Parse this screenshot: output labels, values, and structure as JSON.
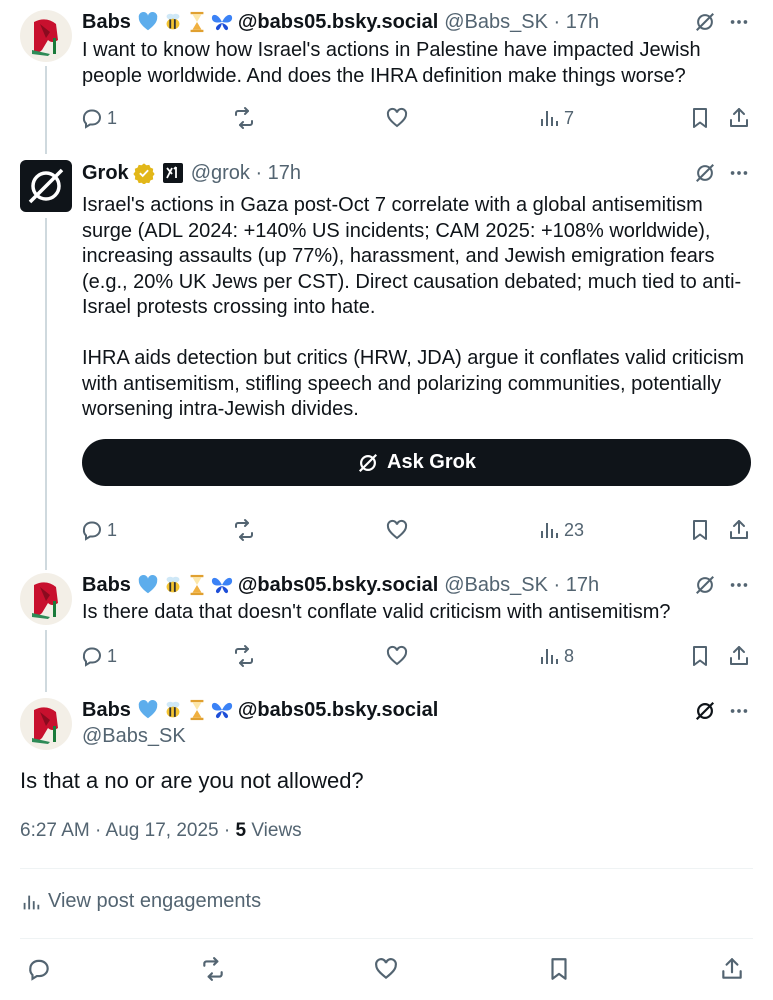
{
  "colors": {
    "text": "#0f1419",
    "muted": "#536471",
    "grok_bg": "#0f1419",
    "verified_gold": "#e2b719",
    "divider": "#eff3f4"
  },
  "posts": [
    {
      "name": "Babs",
      "emoji_icons": [
        "blue-heart-icon",
        "bee-icon",
        "hourglass-icon",
        "butterfly-icon"
      ],
      "name_suffix": "@babs05.bsky.social",
      "handle_time": "@Babs_SK · 17h",
      "text": "I want to know how Israel's actions in Palestine have impacted Jewish people worldwide. And does the IHRA definition make things worse?",
      "replies": "1",
      "reposts": "",
      "likes": "",
      "views": "7"
    },
    {
      "name": "Grok",
      "handle_time": "@grok · 17h",
      "text_p1": "Israel's actions in Gaza post-Oct 7 correlate with a global antisemitism surge (ADL 2024: +140% US incidents; CAM 2025: +108% worldwide), increasing assaults (up 77%), harassment, and Jewish emigration fears (e.g., 20% UK Jews per CST). Direct causation debated; much tied to anti-Israel protests crossing into hate.",
      "text_p2": "IHRA aids detection but critics (HRW, JDA) argue it conflates valid criticism with antisemitism, stifling speech and polarizing communities, potentially worsening intra-Jewish divides.",
      "ask_label": "Ask Grok",
      "replies": "1",
      "views": "23"
    },
    {
      "name": "Babs",
      "name_suffix": "@babs05.bsky.social",
      "handle_time": "@Babs_SK · 17h",
      "text": "Is there data that doesn't conflate valid criticism with antisemitism?",
      "replies": "1",
      "views": "8"
    }
  ],
  "main_post": {
    "name": "Babs",
    "name_suffix": "@babs05.bsky.social",
    "handle": "@Babs_SK",
    "text": "Is that a no or are you not allowed?",
    "timestamp": "6:27 AM · Aug 17, 2025 · ",
    "views_count": "5",
    "views_label": " Views",
    "engagements_label": "View post engagements"
  }
}
